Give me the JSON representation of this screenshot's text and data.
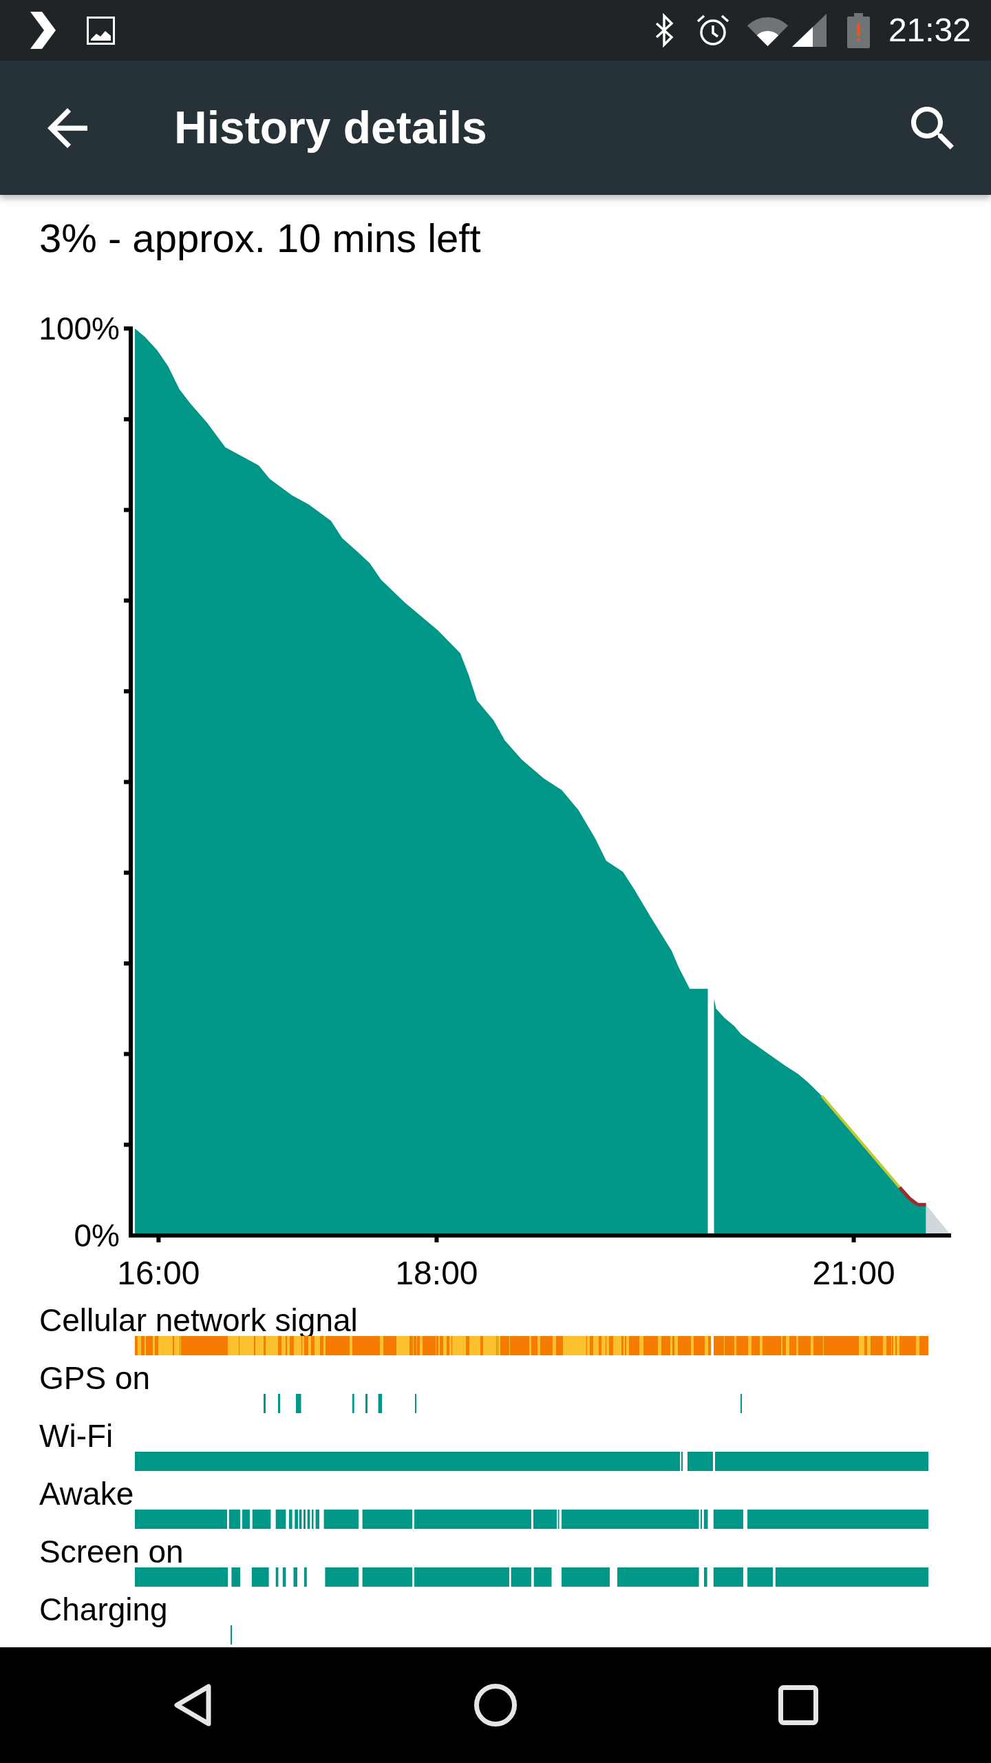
{
  "status_bar": {
    "time": "21:32"
  },
  "app_bar": {
    "title": "History details"
  },
  "summary": "3% - approx. 10 mins left",
  "chart": {
    "chart_data": {
      "type": "area",
      "x": [
        15.83,
        15.9,
        15.99,
        16.07,
        16.15,
        16.23,
        16.35,
        16.48,
        16.72,
        16.8,
        16.96,
        17.08,
        17.24,
        17.32,
        17.43,
        17.52,
        17.6,
        17.77,
        18.01,
        18.17,
        18.23,
        18.29,
        18.41,
        18.49,
        18.61,
        18.77,
        18.9,
        19.02,
        19.14,
        19.22,
        19.34,
        19.42,
        19.54,
        19.69,
        19.74,
        19.82,
        19.94,
        19.97,
        19.995,
        20.01,
        20.07,
        20.14,
        20.19,
        20.26,
        20.37,
        20.5,
        20.6,
        20.67,
        20.77,
        21.33,
        21.4,
        21.46,
        21.52
      ],
      "series": [
        {
          "color": "#009688",
          "values": [
            100,
            99.1,
            97.6,
            95.8,
            93.3,
            91.7,
            89.6,
            86.9,
            84.9,
            83.4,
            81.6,
            80.6,
            78.8,
            76.9,
            75.4,
            74.1,
            72.3,
            69.8,
            66.7,
            64.2,
            61.8,
            59,
            56.8,
            54.6,
            52.5,
            50.4,
            49.1,
            46.9,
            43.8,
            41.3,
            40.1,
            38.2,
            35.1,
            31.4,
            29.6,
            27.2,
            27.2,
            null,
            26.1,
            25,
            24,
            23.1,
            22.2,
            21.4,
            20.2,
            18.8,
            17.8,
            16.9,
            15.4,
            5.3,
            4.1,
            3.4,
            3.4
          ]
        }
      ],
      "xlim": [
        15.8,
        21.7
      ],
      "ylim": [
        0,
        100
      ],
      "xticks": [
        {
          "value": 16,
          "label": "16:00"
        },
        {
          "value": 18,
          "label": "18:00"
        },
        {
          "value": 21,
          "label": "21:00"
        }
      ],
      "yticks": [
        {
          "value": 0,
          "label": "0%"
        },
        {
          "value": 100,
          "label": "100%"
        }
      ]
    }
  },
  "activity_rows": [
    {
      "label": "Cellular network signal",
      "kind": "cellular"
    },
    {
      "label": "GPS on",
      "kind": "gps"
    },
    {
      "label": "Wi-Fi",
      "kind": "wifi"
    },
    {
      "label": "Awake",
      "kind": "awake"
    },
    {
      "label": "Screen on",
      "kind": "screen"
    },
    {
      "label": "Charging",
      "kind": "charging"
    }
  ]
}
